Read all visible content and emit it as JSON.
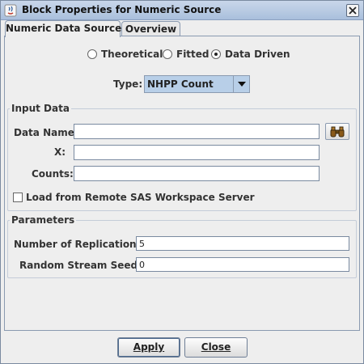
{
  "window": {
    "title": "Block Properties for Numeric Source",
    "close_icon": "close-icon",
    "app_icon": "java-app-icon"
  },
  "tabs": [
    {
      "label": "Numeric Data Source",
      "active": true
    },
    {
      "label": "Overview",
      "active": false
    }
  ],
  "distribution": {
    "options": [
      {
        "label": "Theoretical",
        "selected": false
      },
      {
        "label": "Fitted",
        "selected": false
      },
      {
        "label": "Data Driven",
        "selected": true
      }
    ]
  },
  "type": {
    "label": "Type:",
    "value": "NHPP Count"
  },
  "input_data": {
    "title": "Input Data",
    "data_name": {
      "label": "Data Name:",
      "value": ""
    },
    "x": {
      "label": "X:",
      "value": ""
    },
    "counts": {
      "label": "Counts:",
      "value": ""
    },
    "browse_icon": "binoculars-icon",
    "remote_checkbox": {
      "label": "Load from Remote SAS Workspace Server",
      "checked": false
    }
  },
  "parameters": {
    "title": "Parameters",
    "replications": {
      "label": "Number of Replications :",
      "value": "5"
    },
    "seed": {
      "label": "Random Stream Seed :",
      "value": "0"
    }
  },
  "footer": {
    "apply_label": "Apply",
    "close_label": "Close"
  },
  "colors": {
    "titlebar": "#b9cce4",
    "combo_bg": "#b8cfe8",
    "window_bg": "#eeeeee"
  }
}
